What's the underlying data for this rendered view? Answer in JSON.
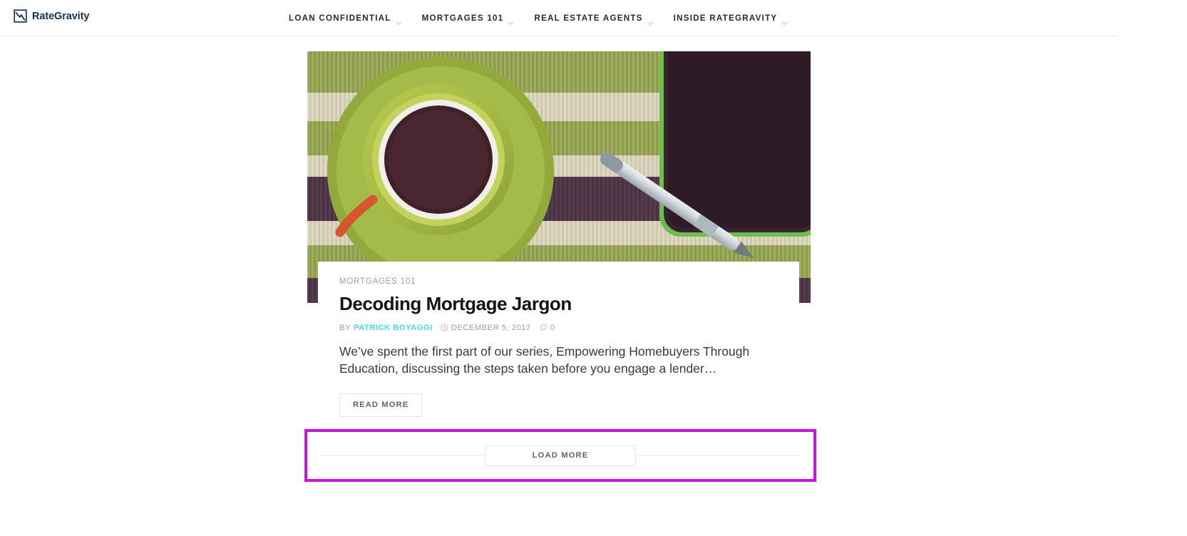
{
  "site": {
    "brand_name": "RateGravity",
    "brand_icon": "chart-square-icon"
  },
  "nav": {
    "items": [
      {
        "label": "LOAN CONFIDENTIAL",
        "icon": "chevron-down-icon"
      },
      {
        "label": "MORTGAGES 101",
        "icon": "chevron-down-icon"
      },
      {
        "label": "REAL ESTATE AGENTS",
        "icon": "chevron-down-icon"
      },
      {
        "label": "INSIDE RATEGRAVITY",
        "icon": "chevron-down-icon"
      }
    ]
  },
  "article": {
    "category": "MORTGAGES 101",
    "title": "Decoding Mortgage Jargon",
    "by_label": "BY",
    "author": "PATRICK BOYAGGI",
    "date": "DECEMBER 5, 2017",
    "comment_count": "0",
    "date_icon": "clock-icon",
    "comment_icon": "speech-bubble-icon",
    "excerpt": "We’ve spent the first part of our series, Empowering Homebuyers Through Education, discussing the steps taken before you engage a lender…",
    "read_more_label": "READ MORE",
    "image_alt": "coffee-cup-phone-stylus-photo"
  },
  "pagination": {
    "load_more_label": "LOAD MORE"
  },
  "colors": {
    "accent_cyan": "#49d6f0",
    "accent_pink": "#f9b8c6",
    "highlight_magenta": "#c715e0",
    "brand_navy": "#16304d",
    "text_dark": "#10131a",
    "text_muted": "#9aa0a6"
  }
}
